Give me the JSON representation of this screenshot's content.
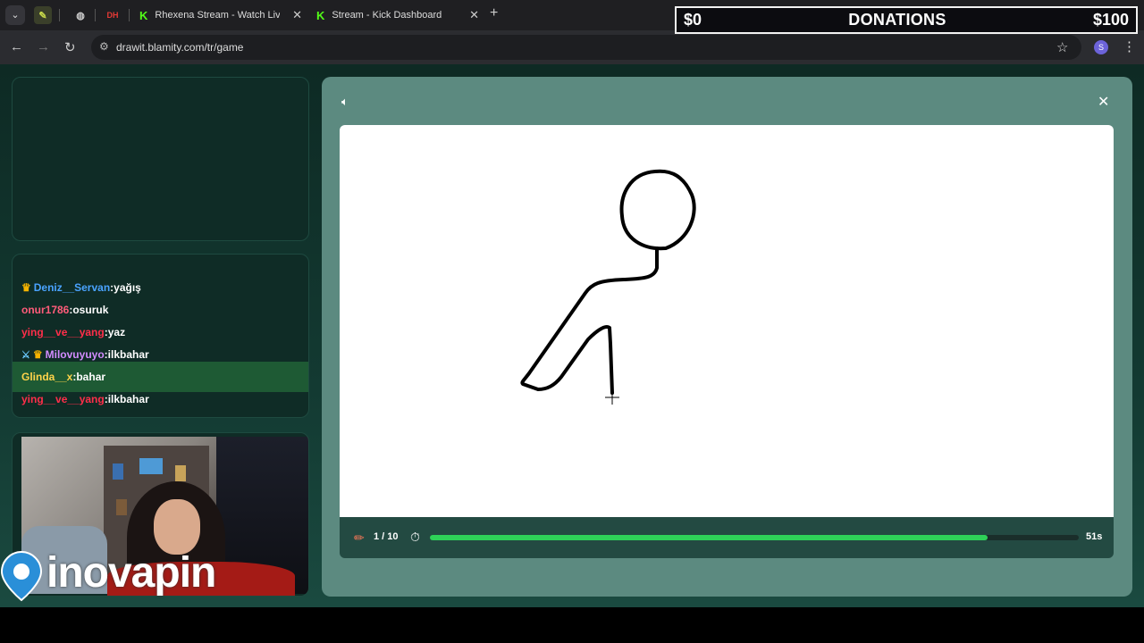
{
  "browser": {
    "tabs": [
      {
        "label": "Rhexena Stream - Watch Live o"
      },
      {
        "label": "Stream - Kick Dashboard"
      }
    ],
    "pinned_badge": "DH",
    "url": "drawit.blamity.com/tr/game",
    "profile_initial": "S"
  },
  "overlay": {
    "donations_left": "$0",
    "donations_title": "DONATIONS",
    "donations_right": "$100"
  },
  "chat": {
    "messages": [
      {
        "user": "Deniz__Servan",
        "text": ":yağış",
        "color": "#4aa3ff",
        "badge": "crown"
      },
      {
        "user": "onur1786",
        "text": ":osuruk",
        "color": "#ff5c7a",
        "badge": ""
      },
      {
        "user": "ying__ve__yang",
        "text": ":yaz",
        "color": "#ff2e4a",
        "badge": ""
      },
      {
        "user": "Milovuyuyo",
        "text": ":ilkbahar",
        "color": "#d28cff",
        "badge": "sword-crown"
      },
      {
        "user": "Glinda__x",
        "text": ":bahar",
        "color": "#ffd34a",
        "badge": ""
      },
      {
        "user": "ying__ve__yang",
        "text": ":ilkbahar",
        "color": "#ff2e4a",
        "badge": ""
      }
    ],
    "highlighted_index": 4
  },
  "stream": {
    "logo_text": "inovapin"
  },
  "game": {
    "round": "1 / 10",
    "time_left": "51s",
    "progress_fraction": 0.86
  }
}
